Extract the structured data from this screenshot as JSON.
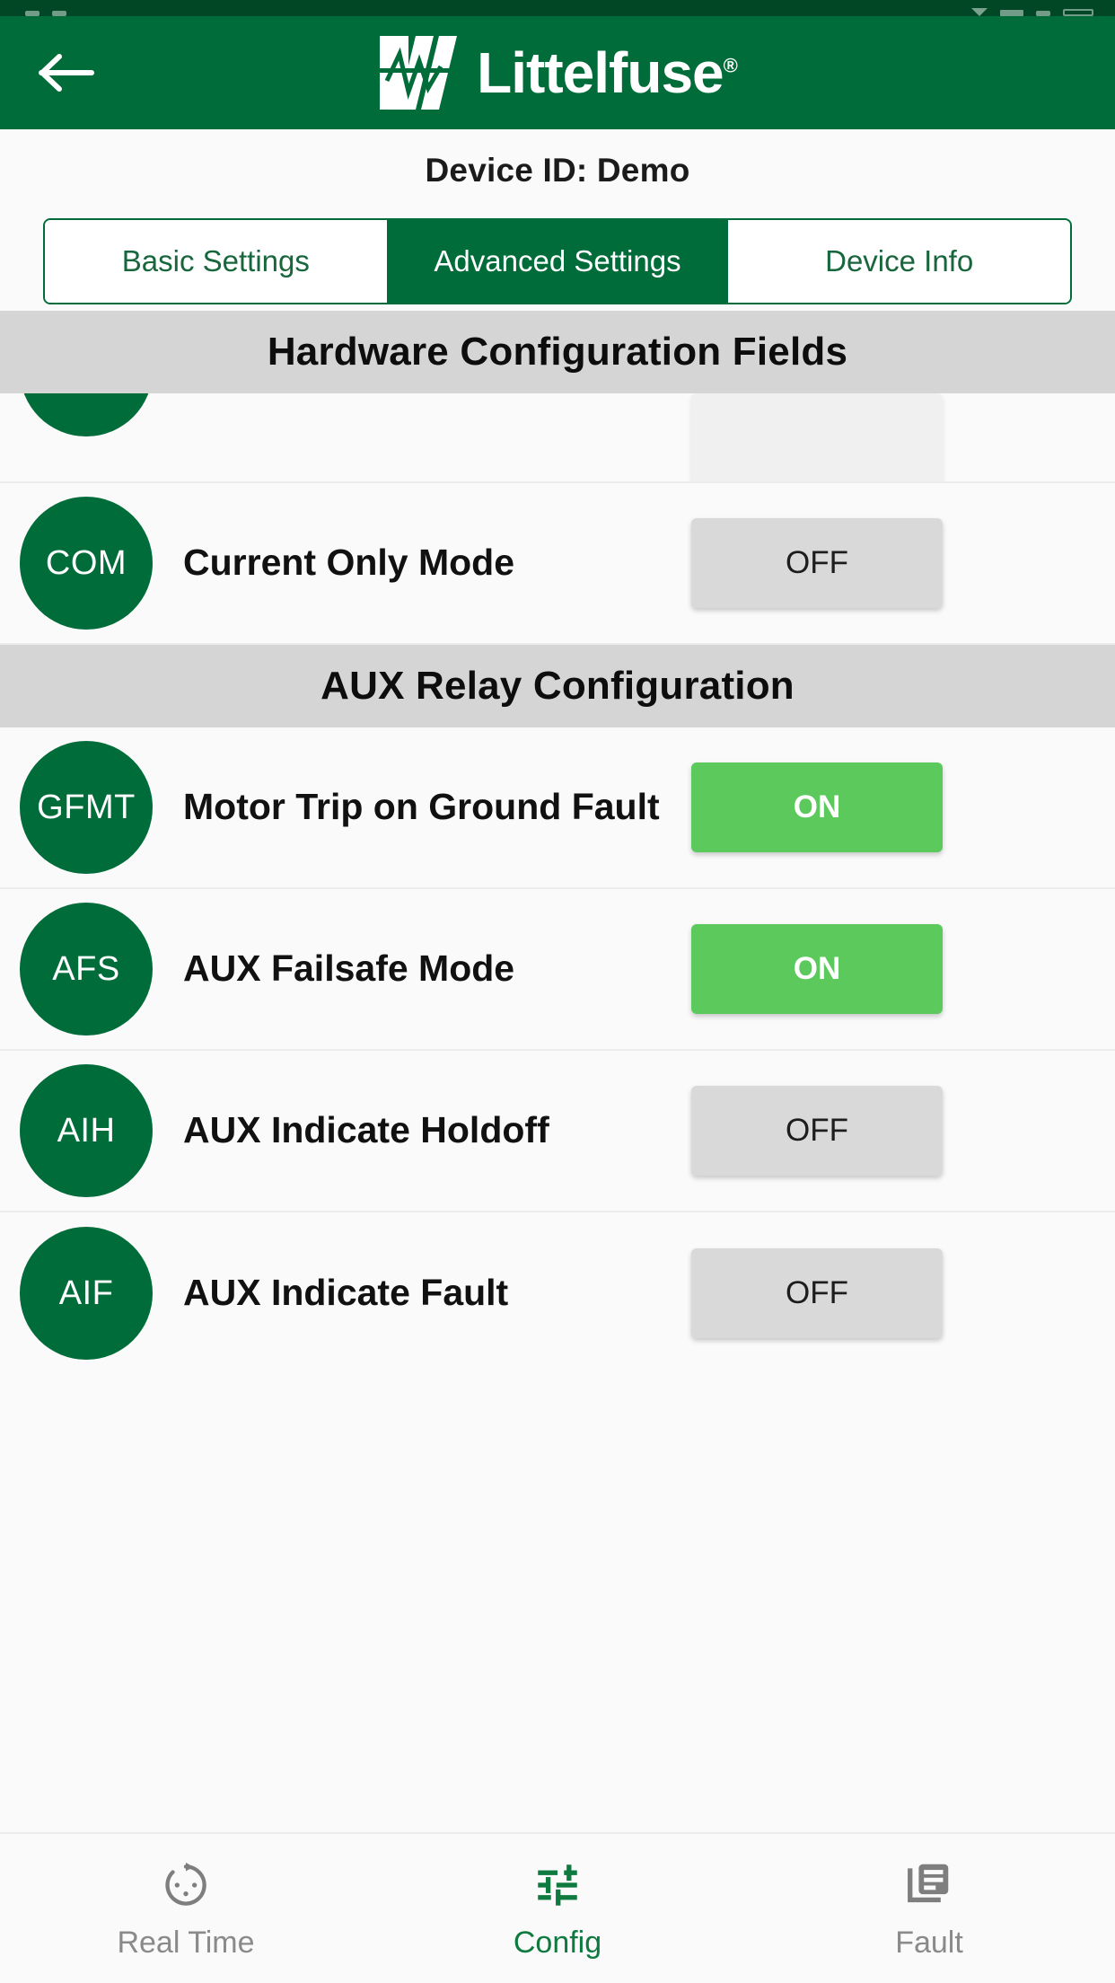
{
  "statusbar": {
    "present": true
  },
  "appbar": {
    "back_icon": "arrow-left-icon",
    "brand_name": "Littelfuse",
    "brand_reg": "®",
    "bg_color": "#006C39"
  },
  "device": {
    "id_label": "Device ID: Demo"
  },
  "tabs": [
    {
      "label": "Basic Settings",
      "active": false
    },
    {
      "label": "Advanced Settings",
      "active": true
    },
    {
      "label": "Device Info",
      "active": false
    }
  ],
  "sections": [
    {
      "title": "Hardware Configuration Fields",
      "rows": [
        {
          "badge": "",
          "label": "",
          "toggle": "",
          "clipped": true
        },
        {
          "badge": "COM",
          "label": "Current Only Mode",
          "toggle": "OFF",
          "state": "off"
        }
      ]
    },
    {
      "title": "AUX Relay Configuration",
      "rows": [
        {
          "badge": "GFMT",
          "label": "Motor Trip on Ground Fault",
          "toggle": "ON",
          "state": "on"
        },
        {
          "badge": "AFS",
          "label": "AUX Failsafe Mode",
          "toggle": "ON",
          "state": "on"
        },
        {
          "badge": "AIH",
          "label": "AUX Indicate Holdoff",
          "toggle": "OFF",
          "state": "off"
        },
        {
          "badge": "AIF",
          "label": "AUX Indicate Fault",
          "toggle": "OFF",
          "state": "off"
        }
      ]
    }
  ],
  "bottom_nav": [
    {
      "label": "Real Time",
      "icon": "speedometer-icon",
      "active": false
    },
    {
      "label": "Config",
      "icon": "tune-sliders-icon",
      "active": true
    },
    {
      "label": "Fault",
      "icon": "document-list-icon",
      "active": false
    }
  ],
  "colors": {
    "brand_green": "#006C39",
    "toggle_on_green": "#5CC95C",
    "toggle_off_grey": "#d9d9d9",
    "section_header_grey": "#d5d5d5",
    "page_bg": "#fafafa"
  }
}
